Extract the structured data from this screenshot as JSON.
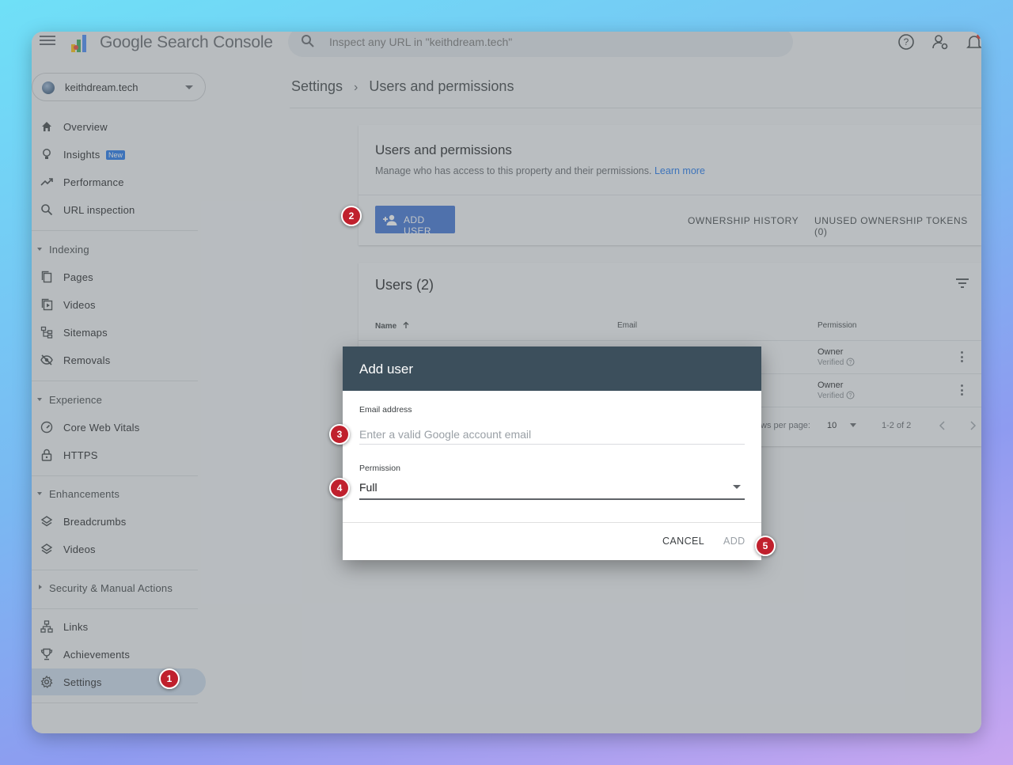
{
  "app": {
    "product_name": "Google Search Console",
    "search_placeholder": "Inspect any URL in \"keithdream.tech\""
  },
  "property": {
    "name": "keithdream.tech"
  },
  "sidebar": {
    "items_top": [
      {
        "label": "Overview",
        "icon": "home-icon"
      },
      {
        "label": "Insights",
        "icon": "lightbulb-icon",
        "badge": "New"
      },
      {
        "label": "Performance",
        "icon": "trending-up-icon"
      },
      {
        "label": "URL inspection",
        "icon": "search-icon"
      }
    ],
    "sections": {
      "indexing": "Indexing",
      "experience": "Experience",
      "enhancements": "Enhancements",
      "security": "Security & Manual Actions"
    },
    "indexing_items": [
      {
        "label": "Pages",
        "icon": "pages-icon"
      },
      {
        "label": "Videos",
        "icon": "video-page-icon"
      },
      {
        "label": "Sitemaps",
        "icon": "sitemap-icon"
      },
      {
        "label": "Removals",
        "icon": "eye-off-icon"
      }
    ],
    "experience_items": [
      {
        "label": "Core Web Vitals",
        "icon": "gauge-icon"
      },
      {
        "label": "HTTPS",
        "icon": "lock-icon"
      }
    ],
    "enhancements_items": [
      {
        "label": "Breadcrumbs",
        "icon": "layers-icon"
      },
      {
        "label": "Videos",
        "icon": "layers-icon"
      }
    ],
    "items_bottom": [
      {
        "label": "Links",
        "icon": "links-icon"
      },
      {
        "label": "Achievements",
        "icon": "trophy-icon"
      },
      {
        "label": "Settings",
        "icon": "gear-icon",
        "active": true
      }
    ]
  },
  "breadcrumb": {
    "parent": "Settings",
    "separator": "›",
    "current": "Users and permissions"
  },
  "permissions_card": {
    "title": "Users and permissions",
    "description": "Manage who has access to this property and their permissions.",
    "learn_more": "Learn more",
    "add_user_label": "ADD USER",
    "ownership_history_label": "OWNERSHIP HISTORY",
    "unused_tokens_label": "UNUSED OWNERSHIP TOKENS (0)"
  },
  "users_card": {
    "title": "Users (2)",
    "columns": {
      "name": "Name",
      "email": "Email",
      "permission": "Permission"
    },
    "rows": [
      {
        "permission": "Owner",
        "status": "Verified"
      },
      {
        "permission": "Owner",
        "status": "Verified"
      }
    ],
    "rows_per_page_label": "ws per page:",
    "rows_per_page_value": "10",
    "range_label": "1-2 of 2"
  },
  "dialog": {
    "title": "Add user",
    "email_label": "Email address",
    "email_placeholder": "Enter a valid Google account email",
    "email_value": "",
    "permission_label": "Permission",
    "permission_value": "Full",
    "cancel_label": "CANCEL",
    "add_label": "ADD"
  },
  "steps": [
    "1",
    "2",
    "3",
    "4",
    "5"
  ],
  "colors": {
    "accent": "#3a6fd0",
    "dialog_header": "#3c4f5c",
    "step_marker": "#c0202d"
  }
}
